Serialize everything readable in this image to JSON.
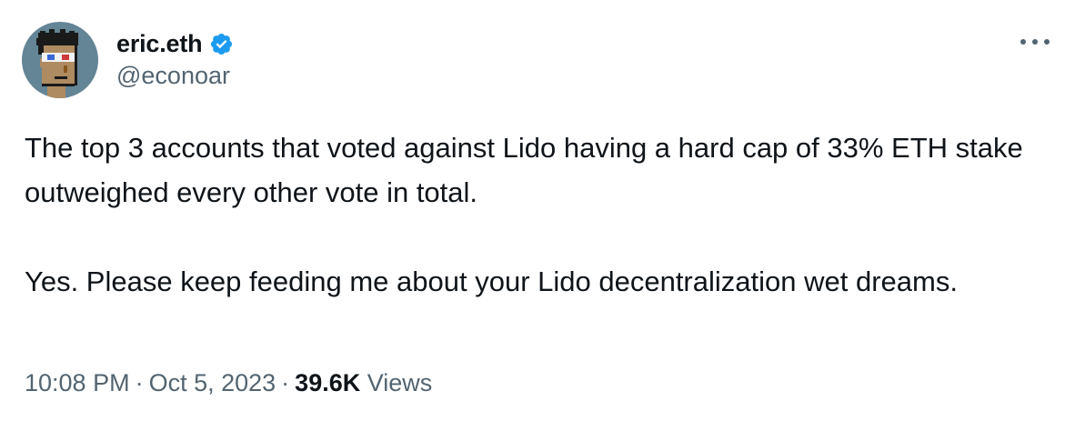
{
  "author": {
    "display_name": "eric.eth",
    "handle": "@econoar",
    "avatar_icon": "pixel-punk-avatar-icon",
    "verified_icon": "verified-badge-icon",
    "verified_color": "#1d9bf0"
  },
  "more_icon": "more-options-icon",
  "tweet": {
    "paragraphs": [
      "The top 3 accounts that voted against Lido having a hard cap of 33% ETH stake outweighed every other vote in total.",
      "Yes. Please keep feeding me about your Lido decentralization wet dreams."
    ]
  },
  "meta": {
    "time": "10:08 PM",
    "separator": "·",
    "date": "Oct 5, 2023",
    "views_count": "39.6K",
    "views_label": "Views"
  },
  "colors": {
    "text": "#0f1419",
    "secondary": "#536471",
    "avatar_bg": "#638596"
  }
}
